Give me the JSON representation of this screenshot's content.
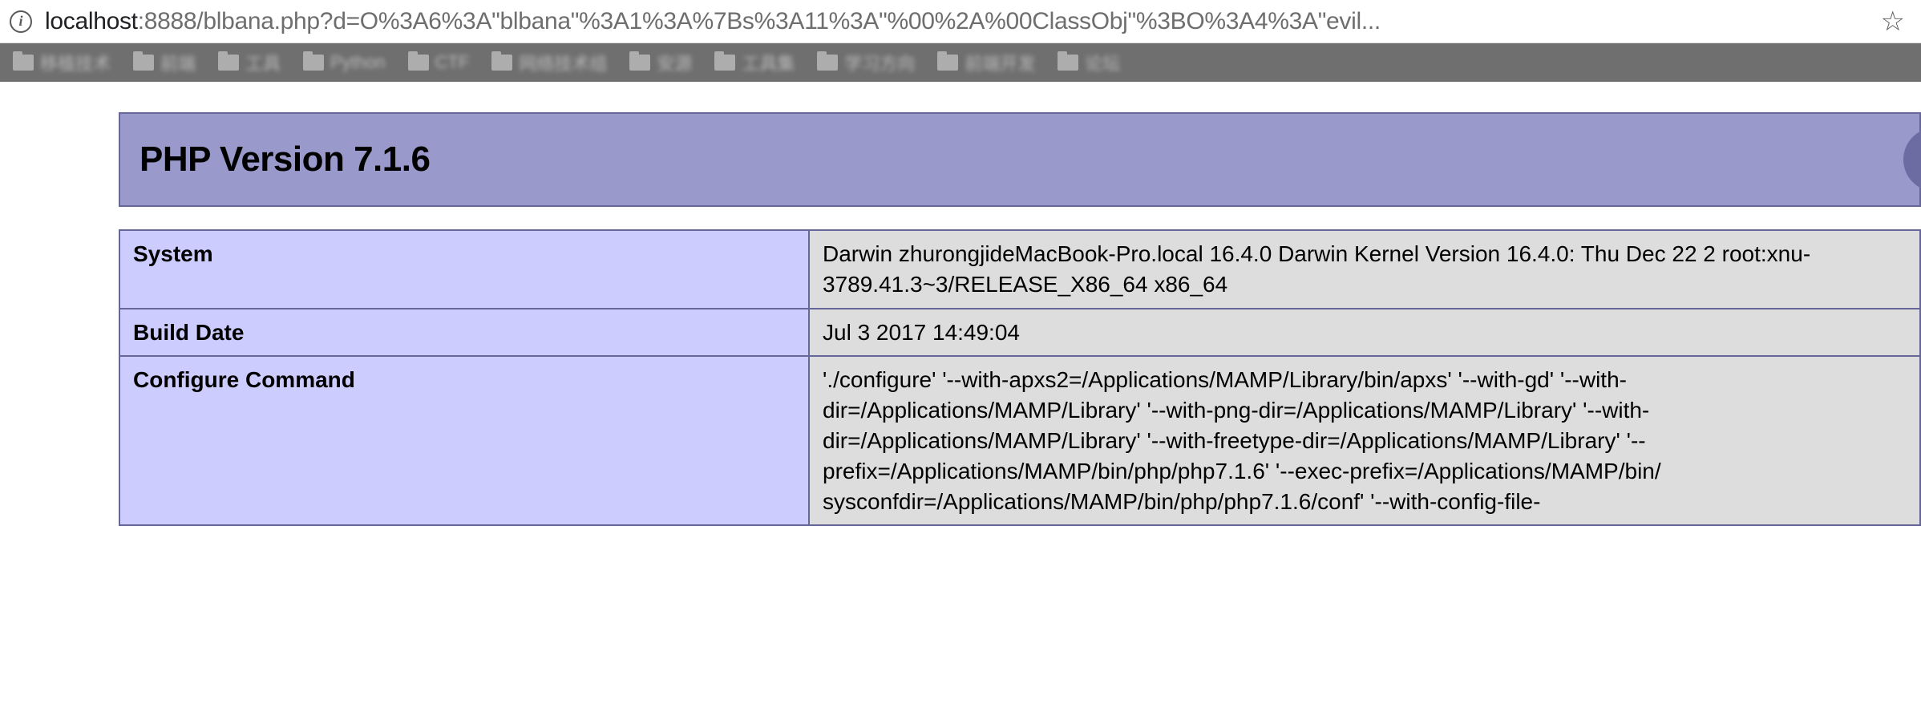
{
  "browser": {
    "url_prefix": "localhost",
    "url_suffix": ":8888/blbana.php?d=O%3A6%3A\"blbana\"%3A1%3A%7Bs%3A11%3A\"%00%2A%00ClassObj\"%3BO%3A4%3A\"evil...",
    "bookmarks": [
      "移植技术",
      "前端",
      "工具",
      "Python",
      "CTF",
      "网络技术组",
      "安源",
      "工具集",
      "学习方向",
      "前端开发",
      "论坛"
    ]
  },
  "phpinfo": {
    "title": "PHP Version 7.1.6",
    "rows": [
      {
        "key": "System",
        "value": "Darwin zhurongjideMacBook-Pro.local 16.4.0 Darwin Kernel Version 16.4.0: Thu Dec 22 2 root:xnu-3789.41.3~3/RELEASE_X86_64 x86_64"
      },
      {
        "key": "Build Date",
        "value": "Jul 3 2017 14:49:04"
      },
      {
        "key": "Configure Command",
        "value": "'./configure' '--with-apxs2=/Applications/MAMP/Library/bin/apxs' '--with-gd' '--with-dir=/Applications/MAMP/Library' '--with-png-dir=/Applications/MAMP/Library' '--with-dir=/Applications/MAMP/Library' '--with-freetype-dir=/Applications/MAMP/Library' '--prefix=/Applications/MAMP/bin/php/php7.1.6' '--exec-prefix=/Applications/MAMP/bin/ sysconfdir=/Applications/MAMP/bin/php/php7.1.6/conf' '--with-config-file-"
      }
    ]
  }
}
